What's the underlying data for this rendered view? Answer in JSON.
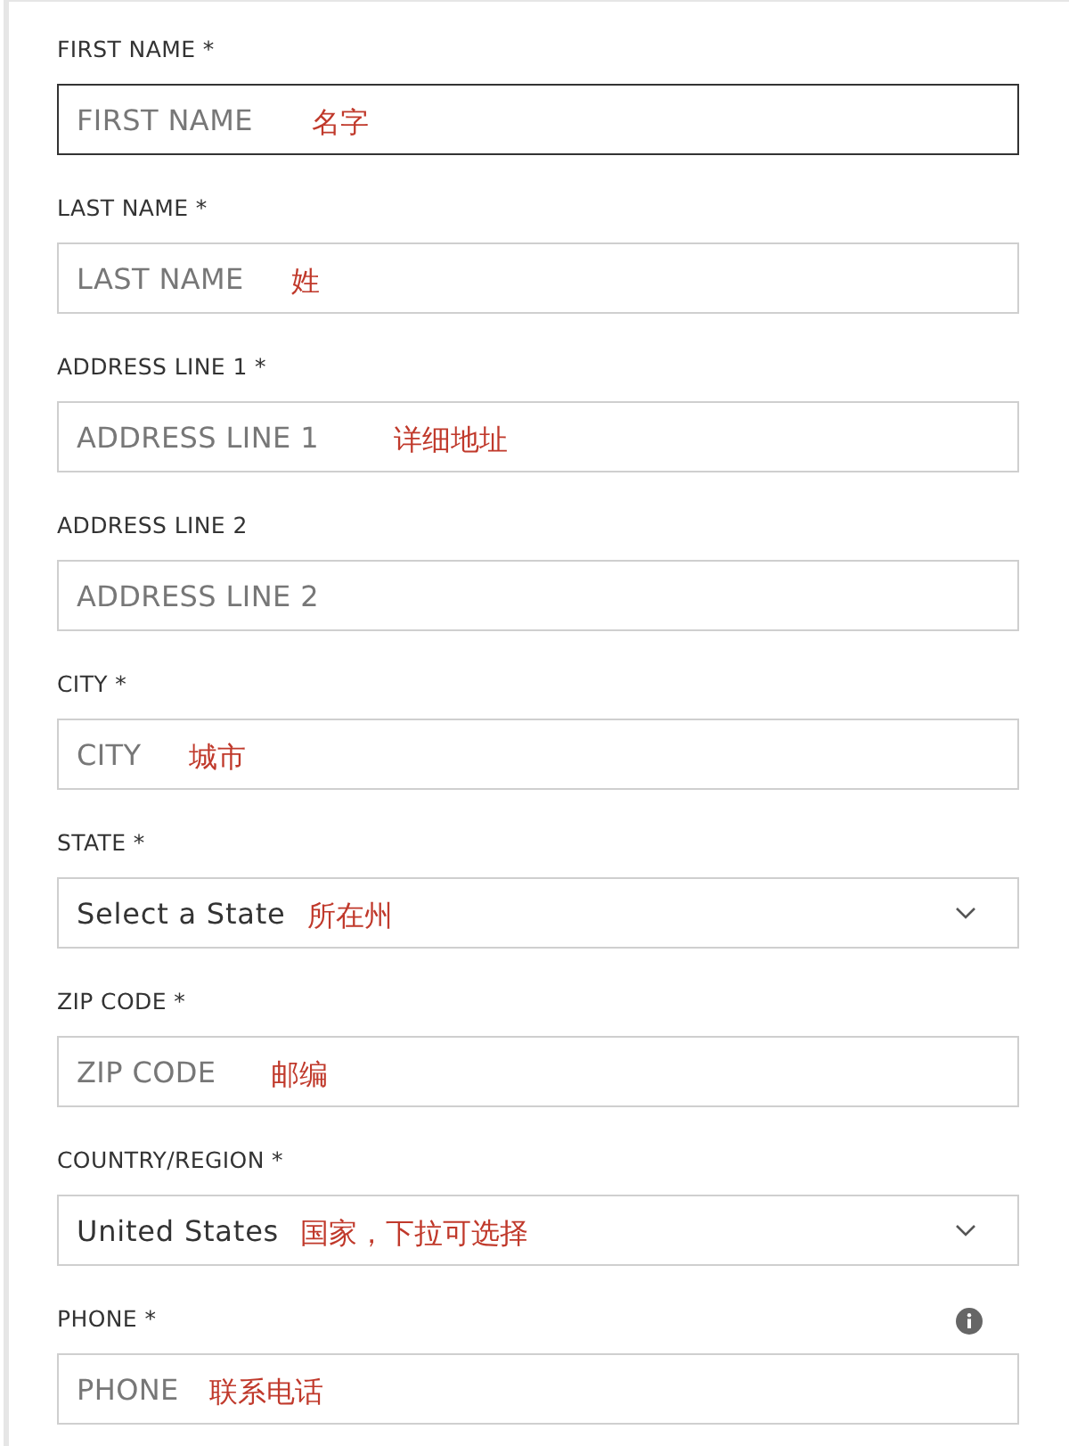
{
  "fields": [
    {
      "kind": "text",
      "label": "FIRST NAME *",
      "placeholder": "FIRST NAME",
      "focused": true,
      "annotation": "名字"
    },
    {
      "kind": "text",
      "label": "LAST NAME *",
      "placeholder": "LAST NAME",
      "focused": false,
      "annotation": "姓"
    },
    {
      "kind": "text",
      "label": "ADDRESS LINE 1 *",
      "placeholder": "ADDRESS LINE 1",
      "focused": false,
      "annotation": "详细地址"
    },
    {
      "kind": "text",
      "label": "ADDRESS LINE 2",
      "placeholder": "ADDRESS LINE 2",
      "focused": false
    },
    {
      "kind": "text",
      "label": "CITY *",
      "placeholder": "CITY",
      "focused": false,
      "annotation": "城市"
    },
    {
      "kind": "select",
      "label": "STATE *",
      "value": "Select a State",
      "focused": false,
      "annotation": "所在州"
    },
    {
      "kind": "text",
      "label": "ZIP CODE *",
      "placeholder": "ZIP CODE",
      "focused": false,
      "annotation": "邮编"
    },
    {
      "kind": "select",
      "label": "COUNTRY/REGION *",
      "value": "United States",
      "focused": false,
      "annotation": "国家，下拉可选择"
    },
    {
      "kind": "text",
      "label": "PHONE *",
      "placeholder": "PHONE",
      "focused": false,
      "annotation": "联系电话",
      "info": true
    }
  ]
}
